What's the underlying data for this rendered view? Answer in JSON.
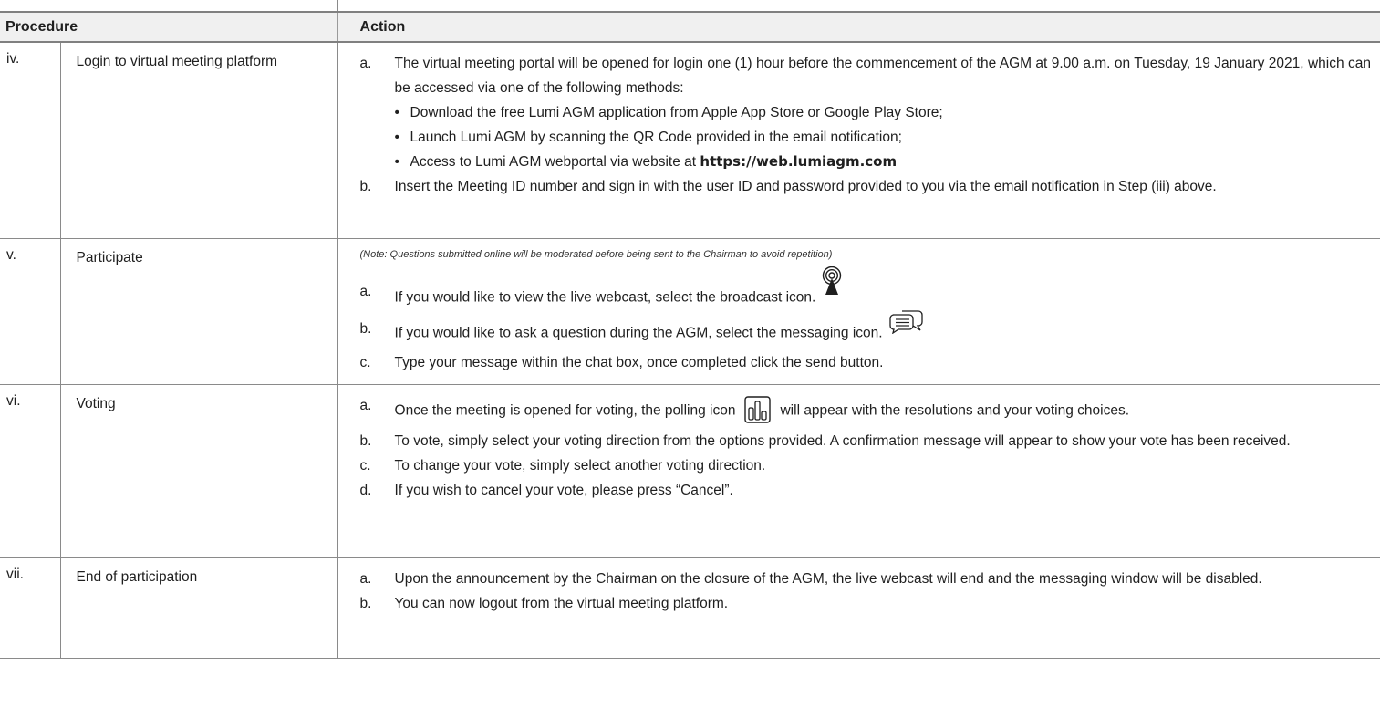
{
  "table": {
    "header": {
      "procedure": "Procedure",
      "action": "Action"
    },
    "rows": [
      {
        "num": "iv.",
        "name": "Login to virtual meeting platform",
        "a_label": "a.",
        "a_text": "The virtual meeting portal will be opened for login one (1) hour before the commencement of the AGM at 9.00 a.m. on Tuesday, 19 January 2021, which can be accessed via one of the following methods:",
        "bullets": [
          "Download the free Lumi AGM application from Apple App Store or Google Play Store;",
          "Launch Lumi AGM by scanning the QR Code provided in the email notification;"
        ],
        "bullet3_prefix": "Access to Lumi AGM webportal via website at ",
        "bullet3_url": "https://web.lumiagm.com",
        "b_label": "b.",
        "b_text": "Insert the Meeting ID number and sign in with the user ID and password provided to you via the email notification in Step (iii) above."
      },
      {
        "num": "v.",
        "name": "Participate",
        "note": "(Note: Questions submitted online will be moderated before being sent to the Chairman to avoid repetition)",
        "a_label": "a.",
        "a_text": "If you would like to view the live webcast, select the broadcast icon.",
        "b_label": "b.",
        "b_text": "If you would like to ask a question during the AGM, select the messaging icon.",
        "c_label": "c.",
        "c_text": "Type your message within the chat box, once completed click the send button."
      },
      {
        "num": "vi.",
        "name": "Voting",
        "a_label": "a.",
        "a_text_before": "Once the meeting is opened for voting, the polling icon",
        "a_text_after": "will appear with the resolutions and your voting choices.",
        "b_label": "b.",
        "b_text": "To vote, simply select your voting direction from the options provided. A confirmation message will appear to show your vote has been received.",
        "c_label": "c.",
        "c_text": "To change your vote, simply select another voting direction.",
        "d_label": "d.",
        "d_text": "If you wish to cancel your vote, please press “Cancel”."
      },
      {
        "num": "vii.",
        "name": "End of participation",
        "a_label": "a.",
        "a_text": "Upon the announcement by the Chairman on the closure of the AGM, the live webcast will end and the messaging window will be disabled.",
        "b_label": "b.",
        "b_text": "You can now logout from the virtual meeting platform."
      }
    ]
  },
  "icons": {
    "broadcast": "broadcast-icon",
    "messaging": "messaging-icon",
    "polling": "polling-icon"
  }
}
